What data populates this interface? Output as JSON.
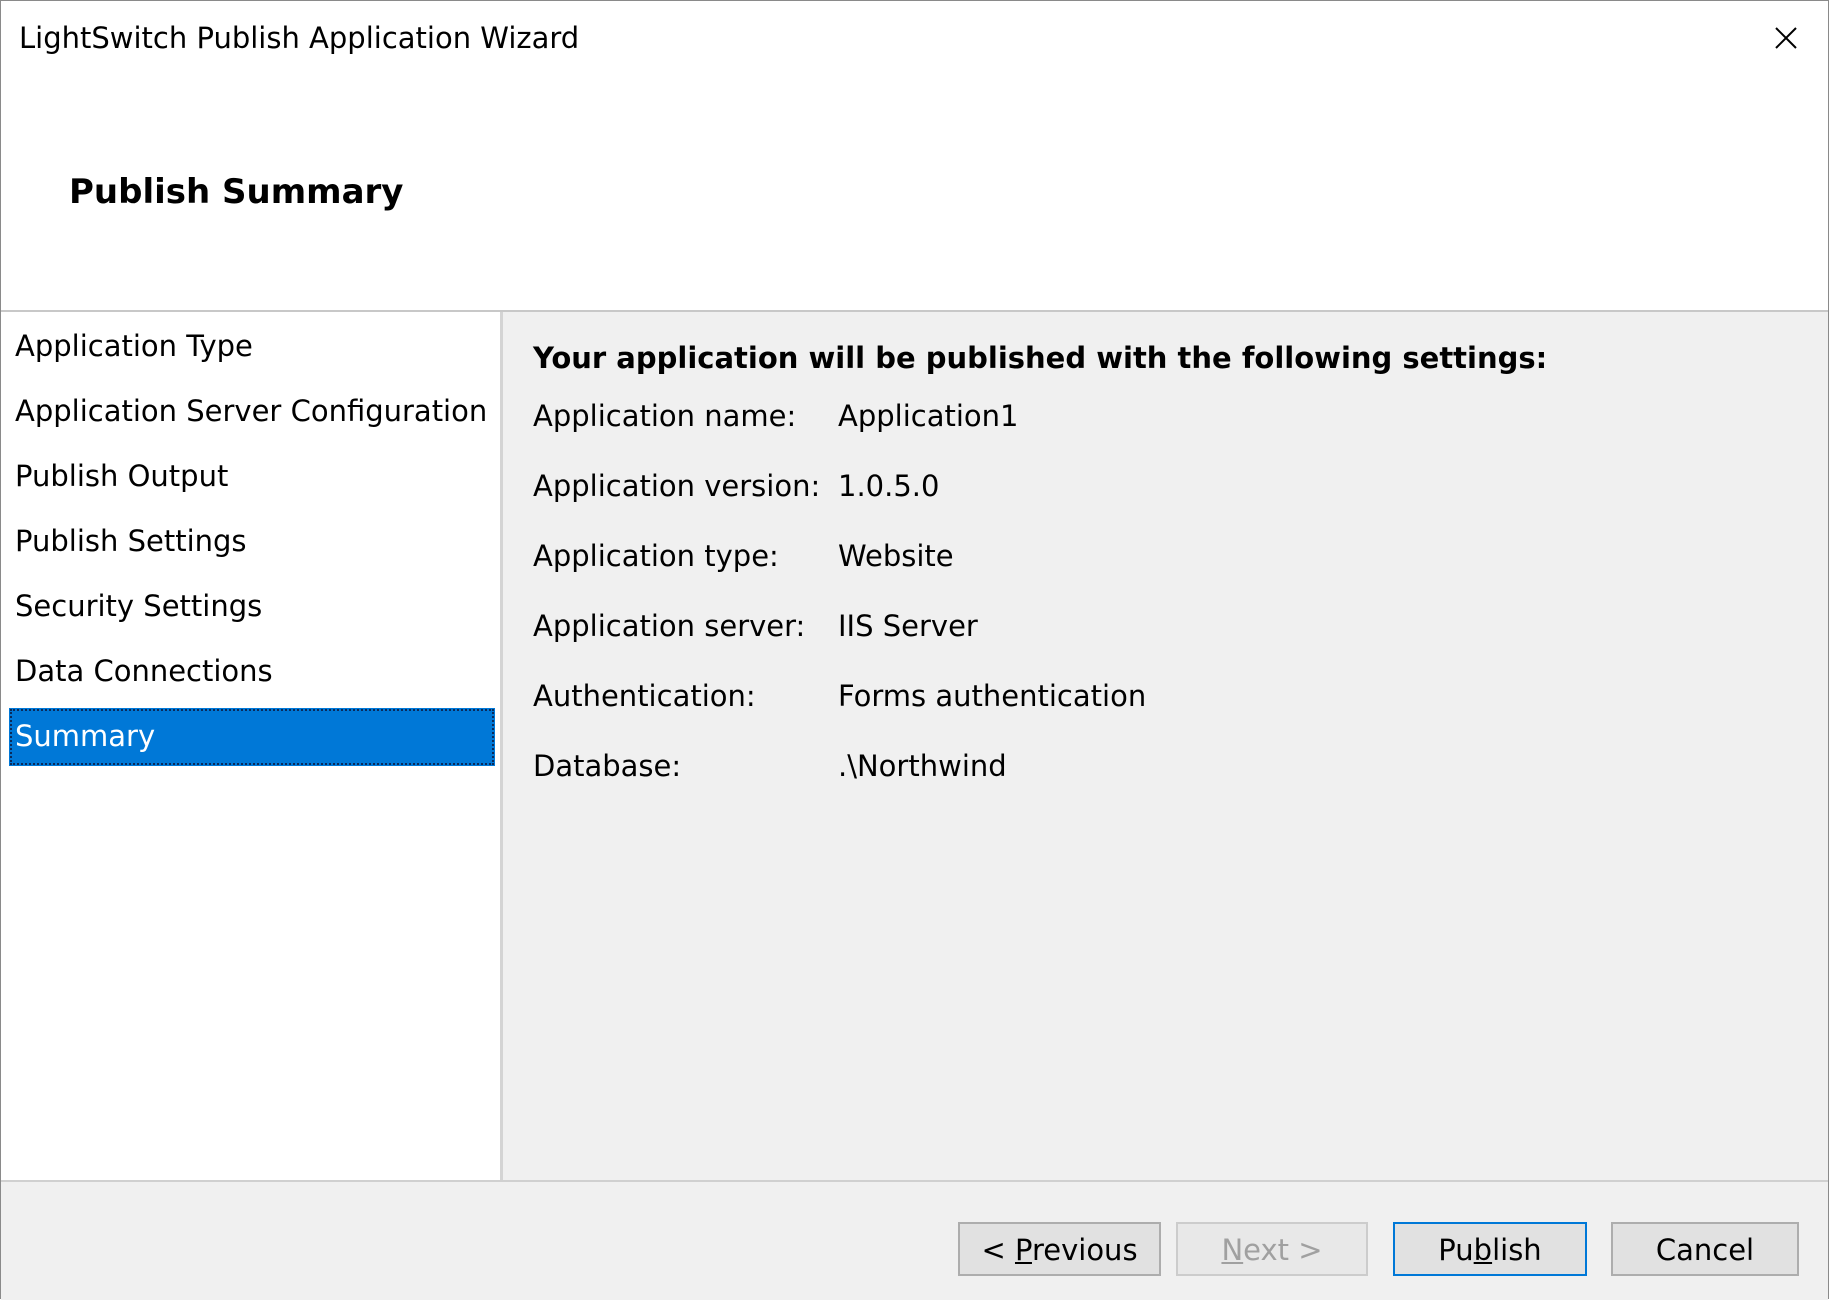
{
  "window": {
    "title": "LightSwitch Publish Application Wizard",
    "close_icon": "close-icon"
  },
  "header": {
    "title": "Publish Summary"
  },
  "sidebar": {
    "items": [
      {
        "label": "Application Type",
        "selected": false
      },
      {
        "label": "Application Server Configuration",
        "selected": false
      },
      {
        "label": "Publish Output",
        "selected": false
      },
      {
        "label": "Publish Settings",
        "selected": false
      },
      {
        "label": "Security Settings",
        "selected": false
      },
      {
        "label": "Data Connections",
        "selected": false
      },
      {
        "label": "Summary",
        "selected": true
      }
    ]
  },
  "main": {
    "heading": "Your application will be published with the following settings:",
    "settings": [
      {
        "label": "Application name:",
        "value": "Application1"
      },
      {
        "label": "Application version:",
        "value": "1.0.5.0"
      },
      {
        "label": "Application type:",
        "value": "Website"
      },
      {
        "label": "Application server:",
        "value": "IIS Server"
      },
      {
        "label": "Authentication:",
        "value": "Forms authentication"
      },
      {
        "label": "Database:",
        "value": ".\\Northwind"
      }
    ]
  },
  "footer": {
    "previous": {
      "before": "< ",
      "mnemonic": "P",
      "after": "revious",
      "enabled": true
    },
    "next": {
      "before": "",
      "mnemonic": "N",
      "after": "ext >",
      "enabled": false
    },
    "publish": {
      "before": "Pu",
      "mnemonic": "b",
      "after": "lish",
      "enabled": true,
      "default": true
    },
    "cancel": {
      "before": "Cancel",
      "mnemonic": "",
      "after": "",
      "enabled": true
    }
  },
  "colors": {
    "selection": "#0078d7",
    "panel_background": "#f0f0f0",
    "window_background": "#ffffff"
  }
}
